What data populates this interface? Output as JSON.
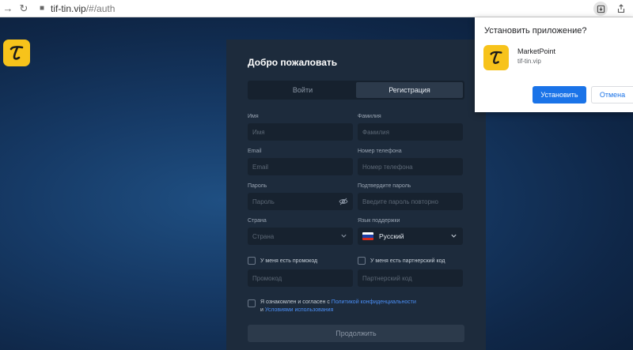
{
  "browser": {
    "url_host": "tif-tin.vip",
    "url_path": "/#/auth"
  },
  "panel": {
    "welcome": "Добро пожаловать",
    "tabs": [
      {
        "label": "Войти",
        "active": false
      },
      {
        "label": "Регистрация",
        "active": true
      }
    ],
    "fields": {
      "first_name": {
        "label": "Имя",
        "placeholder": "Имя"
      },
      "last_name": {
        "label": "Фамилия",
        "placeholder": "Фамилия"
      },
      "email": {
        "label": "Email",
        "placeholder": "Email"
      },
      "phone": {
        "label": "Номер телефона",
        "placeholder": "Номер телефона"
      },
      "password": {
        "label": "Пароль",
        "placeholder": "Пароль"
      },
      "confirm_password": {
        "label": "Подтвердите пароль",
        "placeholder": "Введите пароль повторно"
      },
      "country": {
        "label": "Страна",
        "placeholder": "Страна"
      },
      "support_lang": {
        "label": "Язык поддержки",
        "value": "Русский"
      },
      "promo": {
        "checkbox_label": "У меня есть промокод",
        "placeholder": "Промокод"
      },
      "partner": {
        "checkbox_label": "У меня есть партнерский код",
        "placeholder": "Партнерский код"
      }
    },
    "terms": {
      "line1_prefix": "Я ознакомлен и согласен с ",
      "privacy_link": "Политикой конфиденциальности",
      "line2_prefix": "и ",
      "terms_link": "Условиями использования"
    },
    "continue_label": "Продолжить"
  },
  "popup": {
    "title": "Установить приложение?",
    "app_name": "MarketPoint",
    "app_domain": "tif-tin.vip",
    "install_label": "Установить",
    "cancel_label": "Отмена"
  },
  "colors": {
    "brand_yellow": "#f7c31b",
    "primary_blue": "#1a73e8",
    "link_blue": "#4a8ef5",
    "panel_bg": "#1d2b3c"
  }
}
